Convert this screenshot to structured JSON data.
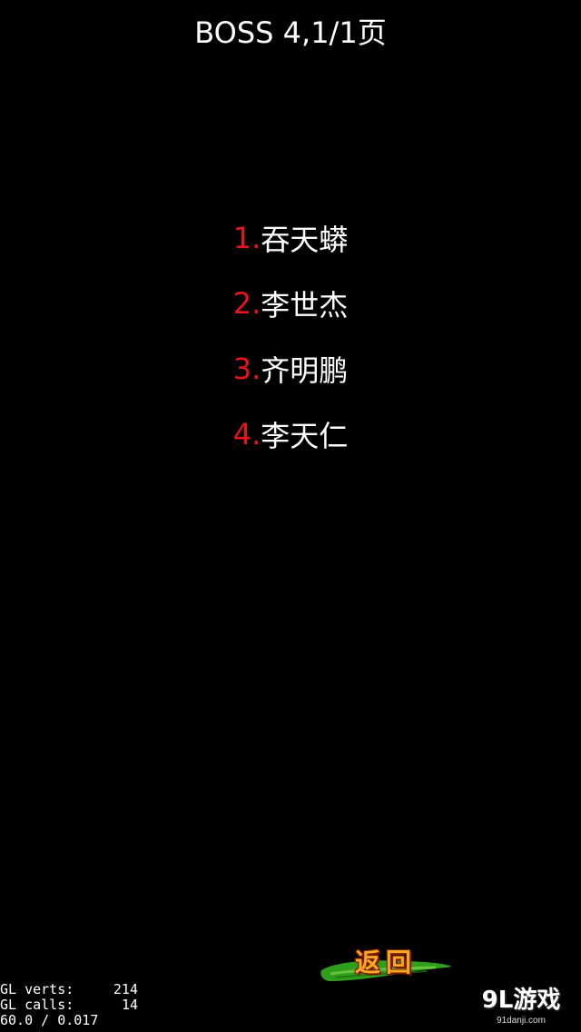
{
  "header": {
    "title": "BOSS 4,1/1页"
  },
  "boss_list": [
    {
      "number": "1.",
      "name": "吞天蟒"
    },
    {
      "number": "2.",
      "name": "李世杰"
    },
    {
      "number": "3.",
      "name": "齐明鹏"
    },
    {
      "number": "4.",
      "name": "李天仁"
    }
  ],
  "back_button": {
    "label": "返回"
  },
  "debug": {
    "verts_label": "GL verts:",
    "verts_value": "214",
    "calls_label": "GL calls:",
    "calls_value": "14",
    "fps": "60.0 / 0.017"
  },
  "watermark": {
    "logo": "9L游戏",
    "url": "91danji.com"
  },
  "colors": {
    "background": "#000000",
    "number_red": "#e8141c",
    "text_white": "#ffffff",
    "button_orange": "#f5a623",
    "brush_green": "#2e9e1c"
  }
}
